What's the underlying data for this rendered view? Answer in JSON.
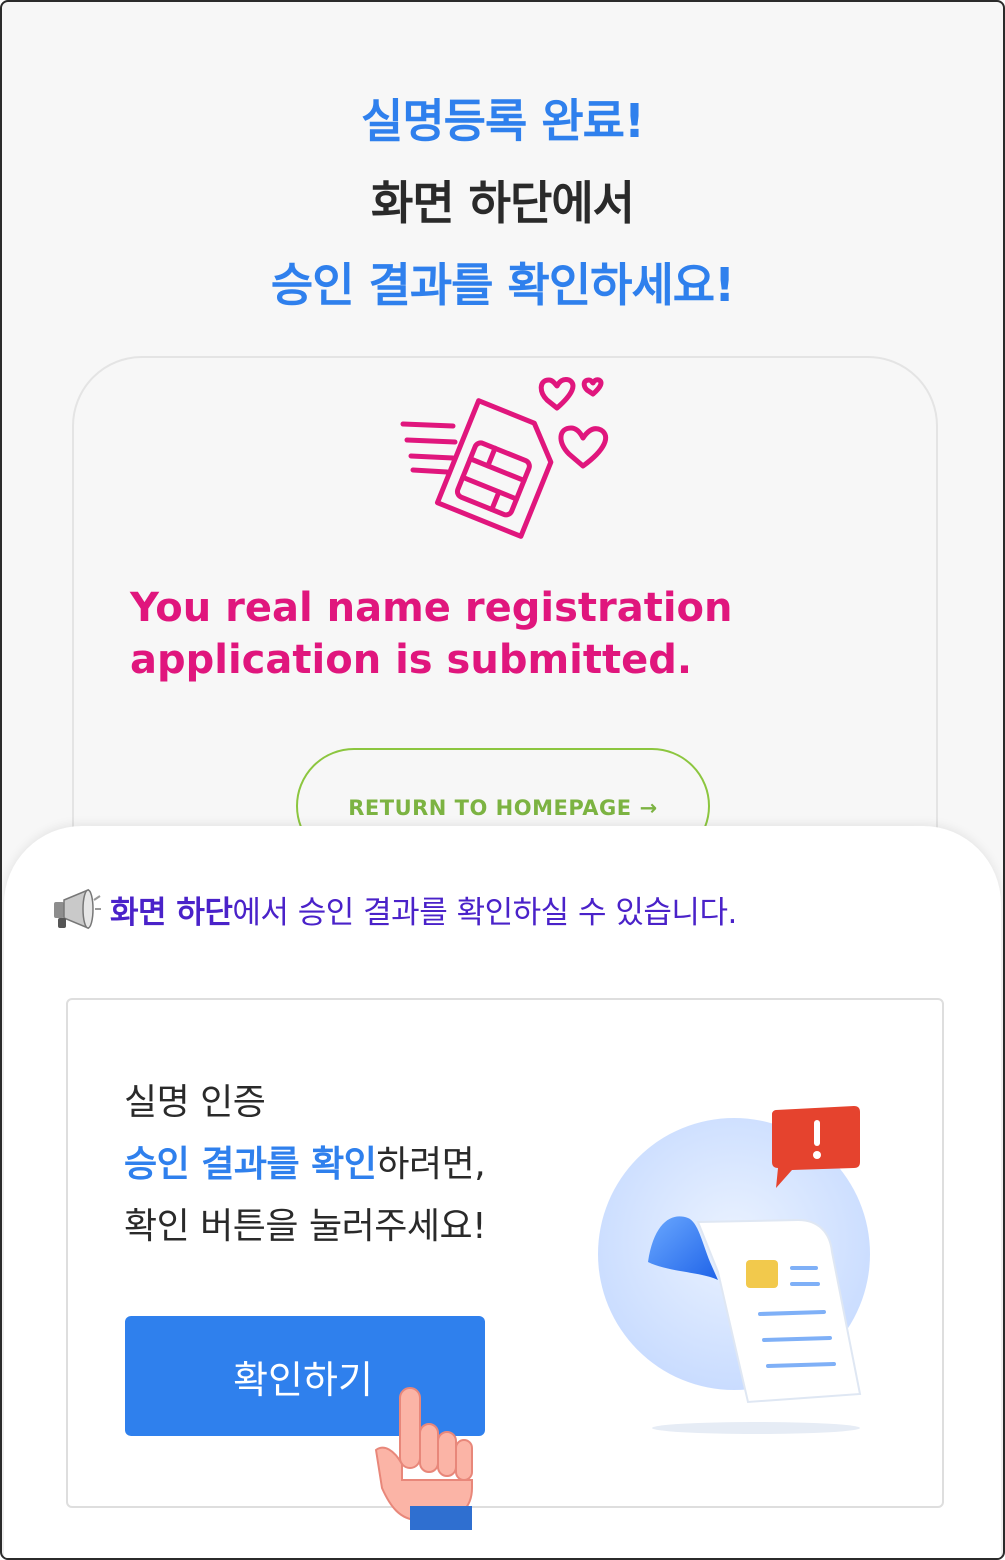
{
  "header": {
    "line1": "실명등록 완료!",
    "line2": "화면 하단에서",
    "line3": "승인 결과를 확인하세요!"
  },
  "background_card": {
    "message_line1": "You real name registration",
    "message_line2": "application is submitted.",
    "return_button": "RETURN TO HOMEPAGE",
    "return_arrow": "→"
  },
  "notice": {
    "icon": "megaphone-icon",
    "emphasis": "화면 하단",
    "rest": "에서 승인 결과를 확인하실 수 있습니다."
  },
  "instruction": {
    "line1": "실명 인증",
    "line2_highlight": "승인 결과를 확인",
    "line2_rest": "하려면,",
    "line3": "확인 버튼을 눌러주세요!"
  },
  "confirm_button": "확인하기",
  "colors": {
    "accent_blue": "#2f80ed",
    "pink": "#e0167d",
    "green": "#8cc63f",
    "purple": "#4a22c9"
  }
}
